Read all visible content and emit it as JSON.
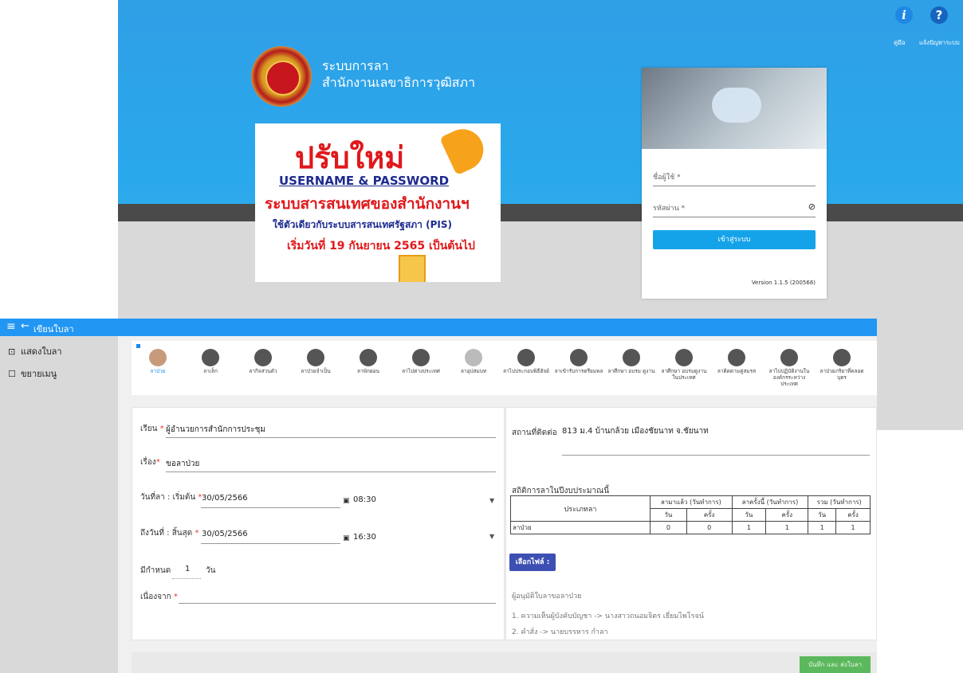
{
  "help": {
    "manual_label": "คู่มือ",
    "report_label": "แจ้งปัญหาระบบ"
  },
  "login": {
    "system_title_line1": "ระบบการลา",
    "system_title_line2": "สำนักงานเลขาธิการวุฒิสภา",
    "username_label": "ชื่อผู้ใช้ *",
    "password_label": "รหัสผ่าน *",
    "login_button": "เข้าสู่ระบบ",
    "version": "Version 1.1.5 (200566)"
  },
  "banner": {
    "line1": "ปรับใหม่",
    "line2": "USERNAME & PASSWORD",
    "line3": "ระบบสารสนเทศของสำนักงานฯ",
    "line4": "ใช้ตัวเดียวกับระบบสารสนเทศรัฐสภา (PIS)",
    "line5": "เริ่มวันที่ 19 กันยายน 2565 เป็นต้นไป"
  },
  "app": {
    "title": "เขียนใบลา",
    "sidebar": [
      {
        "icon": "cast-icon",
        "label": "แสดงใบลา"
      },
      {
        "icon": "edit-icon",
        "label": "ขยายเมนู"
      }
    ]
  },
  "leave_types": [
    {
      "label": "ลาป่วย",
      "icon": "sick-face-icon",
      "active": true
    },
    {
      "label": "ลาเล็ก",
      "icon": "door-exit-icon"
    },
    {
      "label": "ลากิจส่วนตัว",
      "icon": "person-icon"
    },
    {
      "label": "ลาป่วยจำเป็น",
      "icon": "medical-person-icon"
    },
    {
      "label": "ลาพักผ่อน",
      "icon": "hiker-icon"
    },
    {
      "label": "ลาไปต่างประเทศ",
      "icon": "globe-plane-icon"
    },
    {
      "label": "ลาอุปสมบท",
      "icon": "monk-icon"
    },
    {
      "label": "ลาไปประกอบพิธีฮัจย์",
      "icon": "hajj-icon"
    },
    {
      "label": "ลาเข้ารับการตรียมพล",
      "icon": "soldier-icon"
    },
    {
      "label": "ลาศึกษา อบรม ดูงาน",
      "icon": "study-globe-icon"
    },
    {
      "label": "ลาศึกษา อบรมดูงานในประเทศ",
      "icon": "study-person-icon"
    },
    {
      "label": "ลาติดตามคู่สมรส",
      "icon": "couple-icon"
    },
    {
      "label": "ลาไปปฏิบัติงานในองค์กรระหว่างประเทศ",
      "icon": "presentation-icon"
    },
    {
      "label": "ลาป่วยภริยาที่คลอดบุตร",
      "icon": "family-icon"
    }
  ],
  "form": {
    "to_label": "เรียน",
    "to_value": "ผู้อำนวยการสำนักการประชุม",
    "subject_label": "เรื่อง",
    "subject_value": "ขอลาป่วย",
    "start_label": "วันที่ลา : เริ่มต้น",
    "start_date": "30/05/2566",
    "start_time": "08:30",
    "end_label": "ถึงวันที่ : สิ้นสุด",
    "end_date": "30/05/2566",
    "end_time": "16:30",
    "days_label": "มีกำหนด",
    "days_value": "1",
    "days_unit": "วัน",
    "reason_label": "เนื่องจาก"
  },
  "contact": {
    "label": "สถานที่ติดต่อ",
    "value": "813 ม.4 บ้านกล้วย เมืองชัยนาท จ.ชัยนาท"
  },
  "stats": {
    "title": "สถิติการลาในปีงบประมาณนี้",
    "type_header": "ประเภทลา",
    "groups": [
      "ลามาแล้ว (วันทำการ)",
      "ลาครั้งนี้ (วันทำการ)",
      "รวม (วันทำการ)"
    ],
    "sub_headers": [
      "วัน",
      "ครั้ง",
      "วัน",
      "ครั้ง",
      "วัน",
      "ครั้ง"
    ],
    "row": {
      "type": "ลาป่วย",
      "values": [
        "0",
        "0",
        "1",
        "1",
        "1",
        "1"
      ]
    }
  },
  "file_button": "เลือกไฟล์ :",
  "approvers": {
    "title": "ผู้อนุมัติใบลาขอลาป่วย",
    "line1": "1. ความเห็นผู้บังคับบัญชา -> นางสาวถนอมจิตร เยี่ยมไพโรจน์",
    "line2": "2. คำสั่ง -> นายบรรหาร กำลา"
  },
  "submit_button": "บันทึก และ ส่งใบลา"
}
